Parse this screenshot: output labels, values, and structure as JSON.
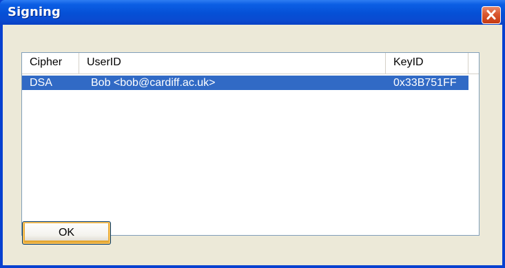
{
  "window": {
    "title": "Signing"
  },
  "table": {
    "columns": [
      "Cipher",
      "UserID",
      "KeyID"
    ],
    "rows": [
      {
        "cipher": "DSA",
        "userid": "Bob <bob@cardiff.ac.uk>",
        "keyid": "0x33B751FF",
        "selected": true
      }
    ]
  },
  "buttons": {
    "ok_label": "OK"
  },
  "colors": {
    "titlebar": "#0550d6",
    "selection": "#316ac5",
    "client_bg": "#ece9d8",
    "close_button": "#d9572f"
  }
}
